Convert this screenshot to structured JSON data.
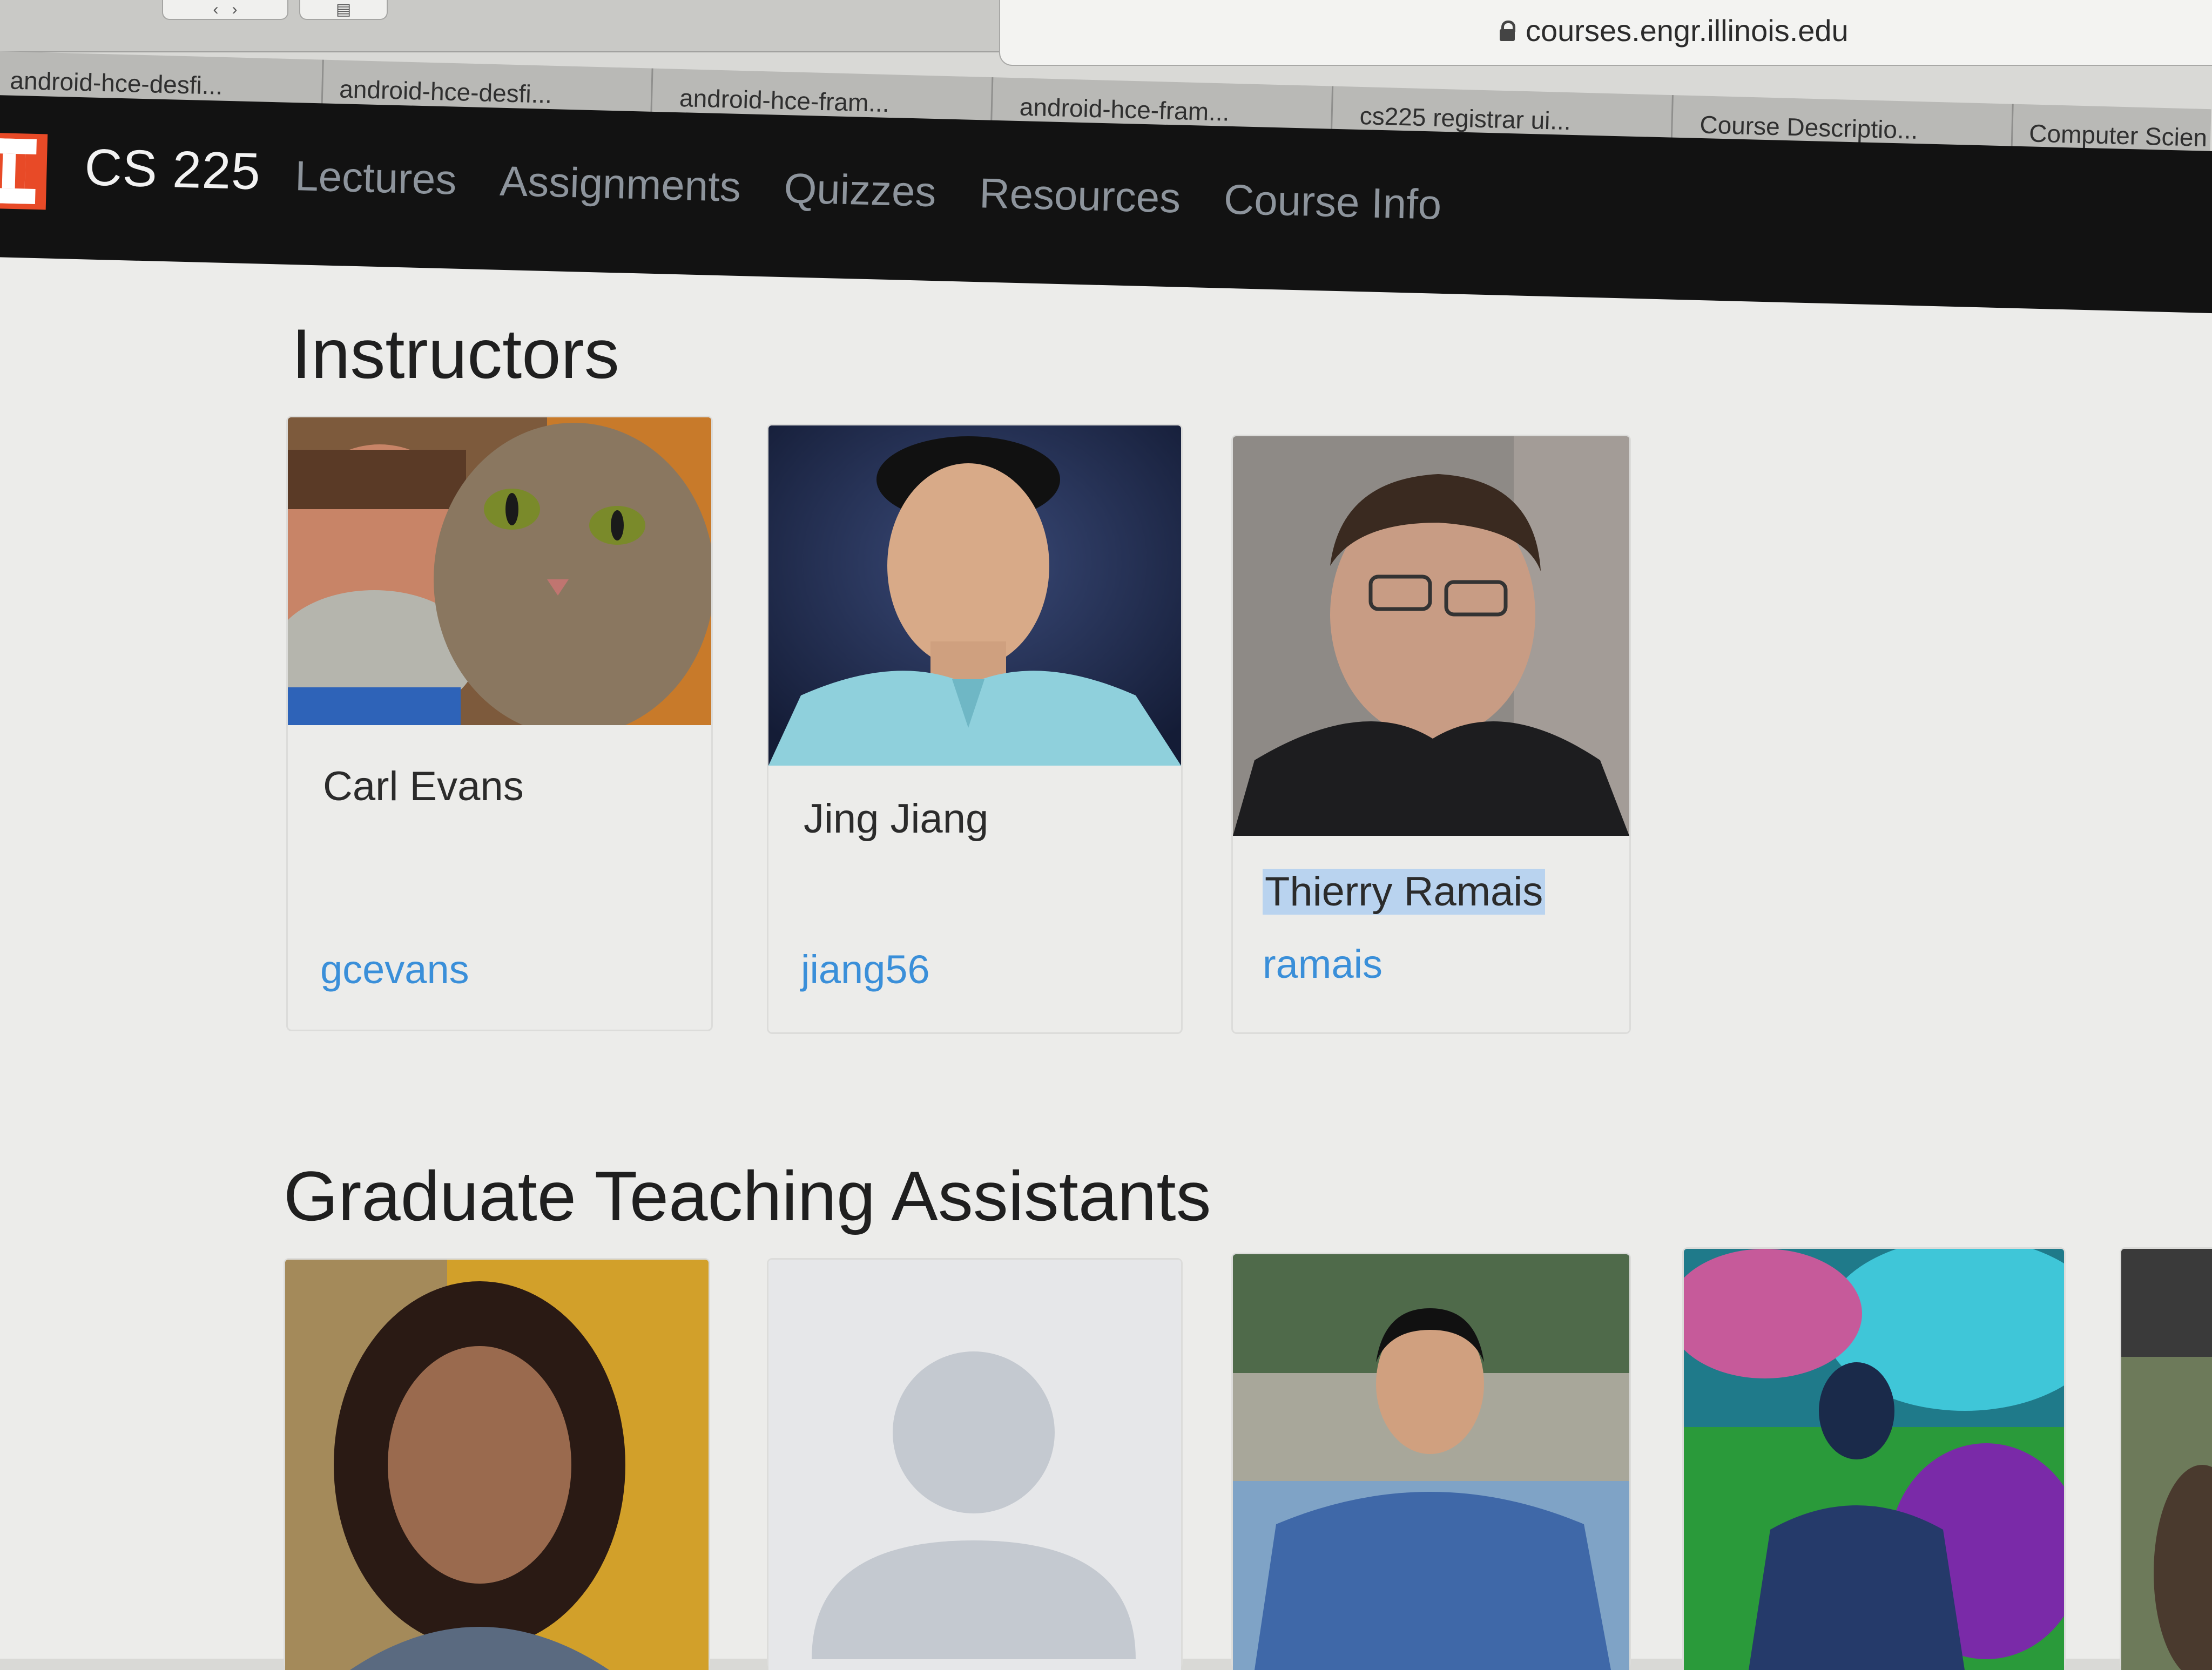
{
  "browser": {
    "url": "courses.engr.illinois.edu",
    "tabs": [
      "android-hce-desfi...",
      "android-hce-desfi...",
      "android-hce-fram...",
      "android-hce-fram...",
      "cs225 registrar ui...",
      "Course Descriptio...",
      "Computer Scien"
    ],
    "nav_buttons": [
      "back-icon",
      "forward-icon",
      "sidebar-icon"
    ]
  },
  "site": {
    "logo_icon": "illinois-block-i-logo",
    "brand": "CS 225",
    "nav": [
      "Lectures",
      "Assignments",
      "Quizzes",
      "Resources",
      "Course Info"
    ],
    "colors": {
      "header": "#121212",
      "logo": "#e84a27",
      "link": "#3a8fd9",
      "nav_text": "#8d949c"
    }
  },
  "instructors": {
    "title": "Instructors",
    "people": [
      {
        "name": "Carl Evans",
        "netid": "gcevans",
        "photo": "man-with-cat-photo"
      },
      {
        "name": "Jing Jiang",
        "netid": "jiang56",
        "photo": "portrait-photo"
      },
      {
        "name": "Thierry Ramais",
        "netid": "ramais",
        "photo": "portrait-photo"
      }
    ]
  },
  "gtas": {
    "title": "Graduate Teaching Assistants",
    "people": [
      {
        "photo": "portrait-photo"
      },
      {
        "photo": "default-avatar-icon"
      },
      {
        "photo": "portrait-photo"
      },
      {
        "photo": "portrait-photo"
      },
      {
        "photo": "portrait-photo"
      }
    ]
  }
}
